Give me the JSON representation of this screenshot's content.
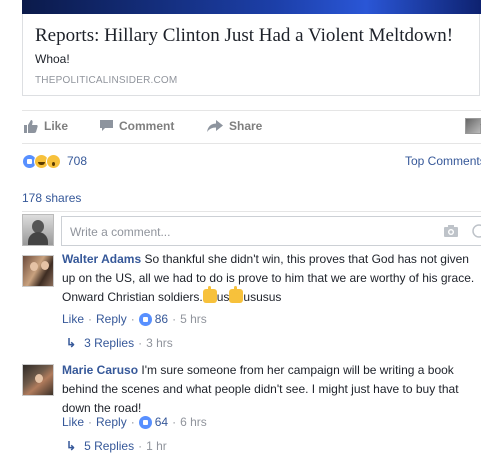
{
  "preview": {
    "title": "Reports: Hillary Clinton Just Had a Violent Meltdown!",
    "description": "Whoa!",
    "domain": "THEPOLITICALINSIDER.COM"
  },
  "actions": {
    "like": "Like",
    "comment": "Comment",
    "share": "Share"
  },
  "reactions": {
    "types": [
      "like",
      "haha",
      "wow"
    ],
    "count": "708",
    "top_comments": "Top Comments"
  },
  "shares": "178 shares",
  "composer": {
    "placeholder": "Write a comment..."
  },
  "comments": [
    {
      "author": "Walter Adams",
      "text_a": "So thankful she didn't win, this proves that God has not given up on the US, all we had to do is prove to him that we are worthy of his grace. Onward Christian soldiers.",
      "text_b": "us",
      "text_c": "ususus",
      "like": "Like",
      "reply": "Reply",
      "likes": "86",
      "time": "5 hrs",
      "replies": "3 Replies",
      "replies_time": "3 hrs"
    },
    {
      "author": "Marie Caruso",
      "text_a": "I'm sure someone from her campaign will be writing a book behind the scenes and what people didn't see. I might just have to buy that down the road!",
      "like": "Like",
      "reply": "Reply",
      "likes": "64",
      "time": "6 hrs",
      "replies": "5 Replies",
      "replies_time": "1 hr"
    }
  ],
  "colors": {
    "link": "#365899",
    "muted": "#90949c",
    "like_blue": "#5890ff",
    "reaction_yellow": "#f7c13b"
  }
}
